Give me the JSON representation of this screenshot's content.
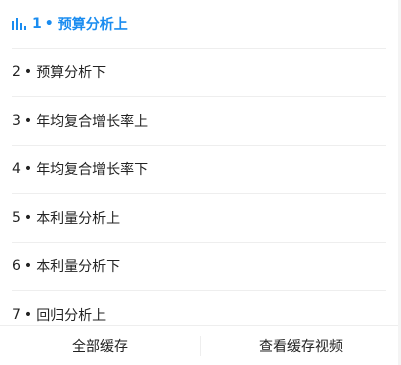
{
  "playlist": {
    "items": [
      {
        "num": "1",
        "sep": "•",
        "title": "预算分析上",
        "active": true,
        "icon": "playing-bars-icon"
      },
      {
        "num": "2",
        "sep": "•",
        "title": "预算分析下",
        "active": false
      },
      {
        "num": "3",
        "sep": "•",
        "title": "年均复合增长率上",
        "active": false
      },
      {
        "num": "4",
        "sep": "•",
        "title": "年均复合增长率下",
        "active": false
      },
      {
        "num": "5",
        "sep": "•",
        "title": "本利量分析上",
        "active": false
      },
      {
        "num": "6",
        "sep": "•",
        "title": "本利量分析下",
        "active": false
      },
      {
        "num": "7",
        "sep": "•",
        "title": "回归分析上",
        "active": false
      }
    ]
  },
  "footer": {
    "cache_all_label": "全部缓存",
    "view_cache_label": "查看缓存视频"
  },
  "colors": {
    "accent": "#1a8cf0",
    "text": "#222222",
    "divider": "#eeeeee"
  }
}
